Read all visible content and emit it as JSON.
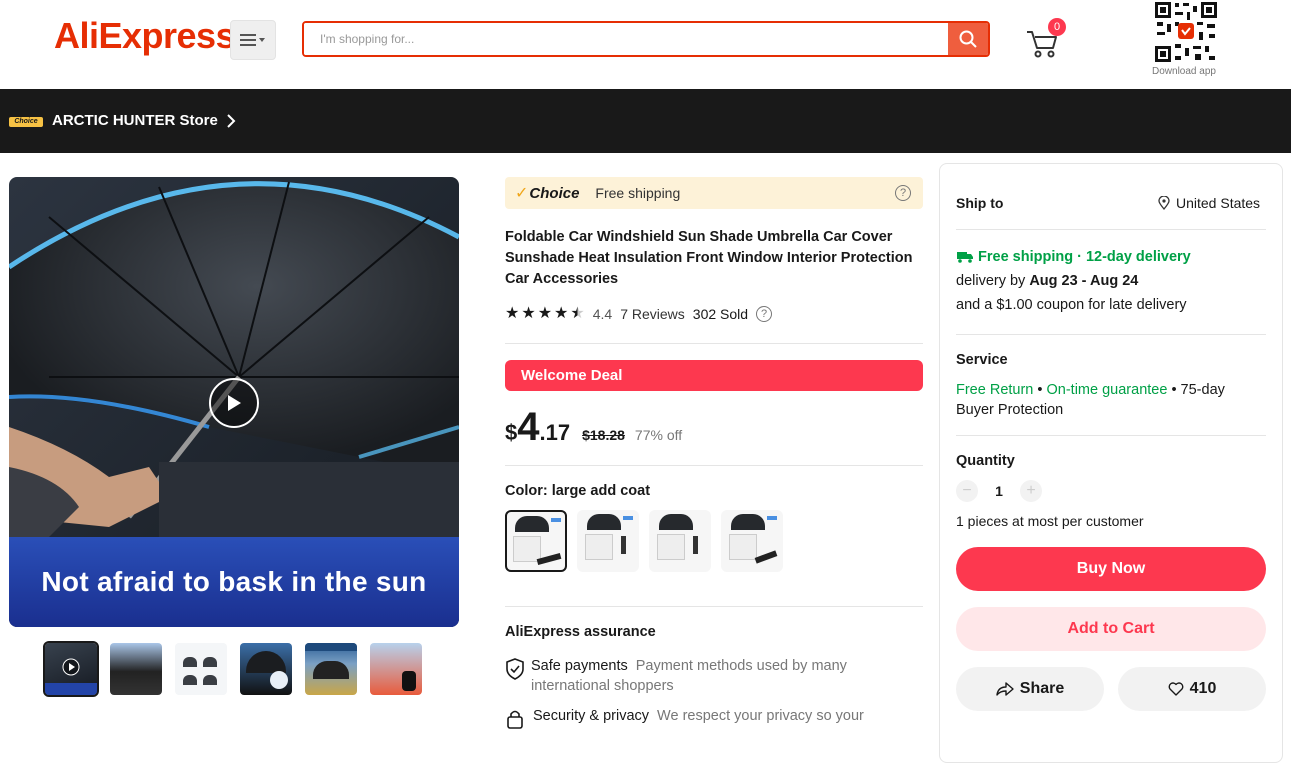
{
  "header": {
    "logo": "AliExpress",
    "logo_mark": "®",
    "search_placeholder": "I'm shopping for...",
    "cart_count": "0",
    "download_label": "Download app"
  },
  "store": {
    "badge": "Choice",
    "name": "ARCTIC HUNTER Store"
  },
  "gallery": {
    "caption": "Not afraid to bask in the sun",
    "thumbnail_count": 6
  },
  "product": {
    "choice_label": "Choice",
    "choice_shipping": "Free shipping",
    "title": "Foldable Car Windshield Sun Shade Umbrella Car Cover Sunshade Heat Insulation Front Window Interior Protection Car Accessories",
    "rating": "4.4",
    "rating_stars": 4.4,
    "reviews": "7 Reviews",
    "sold": "302 Sold",
    "welcome_deal": "Welcome Deal",
    "price_currency": "$",
    "price_int": "4",
    "price_dec": ".17",
    "price_old": "$18.28",
    "discount": "77% off",
    "color_label": "Color: large add coat",
    "assurance_title": "AliExpress assurance",
    "assurance": [
      {
        "title": "Safe payments",
        "desc": "Payment methods used by many international shoppers"
      },
      {
        "title": "Security & privacy",
        "desc": "We respect your privacy so your"
      }
    ]
  },
  "panel": {
    "ship_to_label": "Ship to",
    "country": "United States",
    "free_delivery": "Free shipping · 12-day delivery",
    "delivery_by_label": "delivery by",
    "delivery_dates": "Aug 23 - Aug 24",
    "coupon_note": "and a $1.00 coupon for late delivery",
    "service_label": "Service",
    "service_free_return": "Free Return",
    "service_bullet": " • ",
    "service_ontime": "On-time guarantee",
    "service_rest": " • 75-day Buyer Protection",
    "quantity_label": "Quantity",
    "quantity": "1",
    "quantity_note": "1 pieces at most per customer",
    "buy_now": "Buy Now",
    "add_to_cart": "Add to Cart",
    "share": "Share",
    "wishlist_count": "410"
  },
  "colors": {
    "brand_red": "#e62e04",
    "deal_red": "#fd384f",
    "green": "#00a046",
    "choice_gold": "#f7c244"
  }
}
